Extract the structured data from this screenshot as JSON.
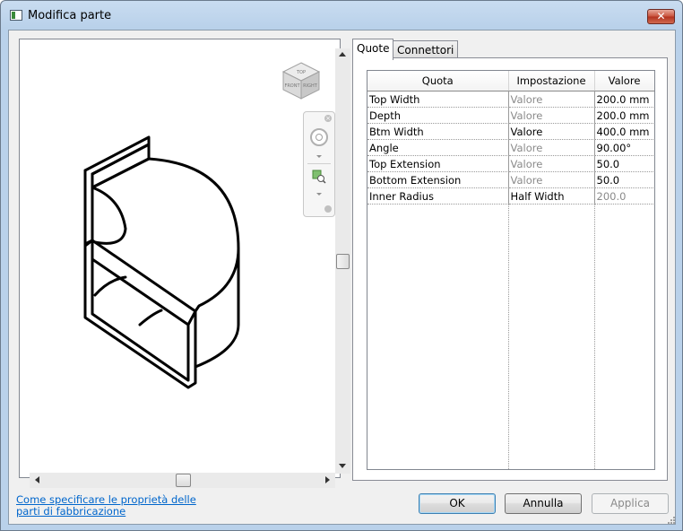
{
  "window": {
    "title": "Modifica parte"
  },
  "tabs": [
    {
      "label": "Quote",
      "active": true
    },
    {
      "label": "Connettori",
      "active": false
    }
  ],
  "grid": {
    "headers": [
      "Quota",
      "Impostazione",
      "Valore"
    ],
    "rows": [
      {
        "quota": "Top Width",
        "impostazione": "Valore",
        "valore": "200.0 mm",
        "impostazione_dim": true,
        "valore_dim": false
      },
      {
        "quota": "Depth",
        "impostazione": "Valore",
        "valore": "200.0 mm",
        "impostazione_dim": true,
        "valore_dim": false
      },
      {
        "quota": "Btm Width",
        "impostazione": "Valore",
        "valore": "400.0 mm",
        "impostazione_dim": false,
        "valore_dim": false
      },
      {
        "quota": "Angle",
        "impostazione": "Valore",
        "valore": "90.00°",
        "impostazione_dim": true,
        "valore_dim": false
      },
      {
        "quota": "Top Extension",
        "impostazione": "Valore",
        "valore": "50.0",
        "impostazione_dim": true,
        "valore_dim": false
      },
      {
        "quota": "Bottom Extension",
        "impostazione": "Valore",
        "valore": "50.0",
        "impostazione_dim": true,
        "valore_dim": false
      },
      {
        "quota": "Inner Radius",
        "impostazione": "Half Width",
        "valore": "200.0",
        "impostazione_dim": false,
        "valore_dim": true
      }
    ]
  },
  "viewcube": {
    "faces": [
      "TOP",
      "FRONT",
      "RIGHT"
    ]
  },
  "help_link": "Come specificare le proprietà delle parti di fabbricazione",
  "buttons": {
    "ok": "OK",
    "cancel": "Annulla",
    "apply": "Applica"
  },
  "icons": {
    "app": "window-icon",
    "close": "close-icon",
    "steering_wheel": "steering-wheel-icon",
    "zoom": "zoom-extents-icon"
  }
}
